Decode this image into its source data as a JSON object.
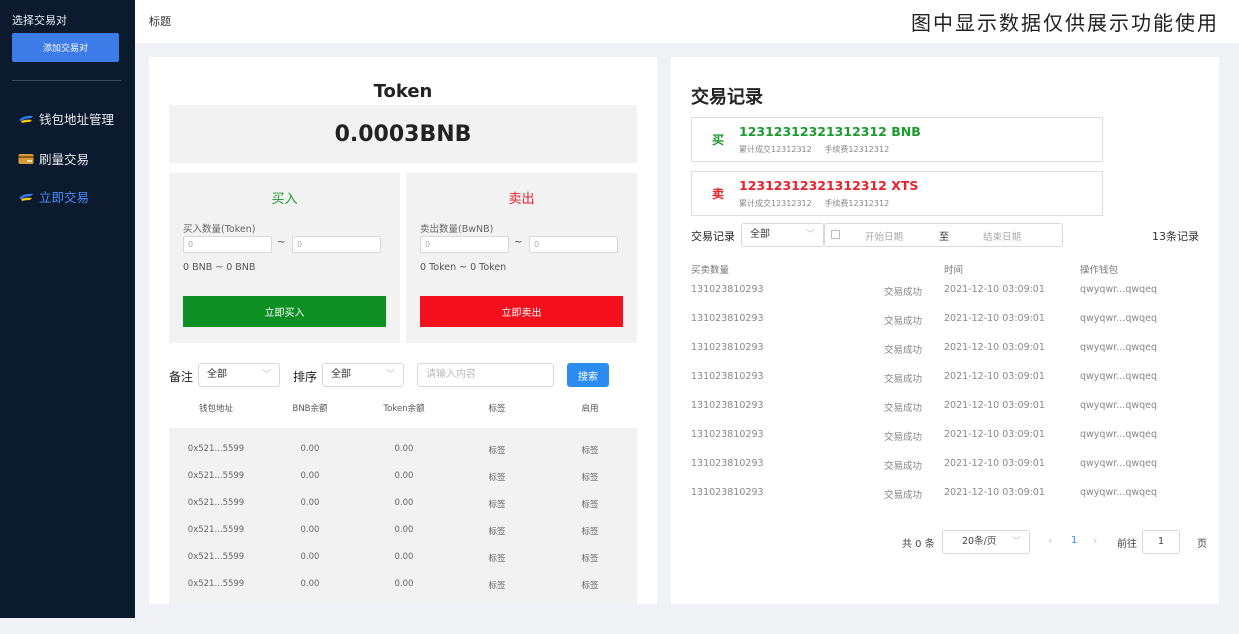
{
  "sidebar": {
    "title": "选择交易对",
    "add_button": "添加交易对",
    "items": [
      {
        "label": "钱包地址管理",
        "icon": "wallet-icon",
        "active": false
      },
      {
        "label": "刷量交易",
        "icon": "card-icon",
        "active": false
      },
      {
        "label": "立即交易",
        "icon": "wallet-icon",
        "active": true
      }
    ]
  },
  "header": {
    "breadcrumb": "标题",
    "notice": "图中显示数据仅供展示功能使用"
  },
  "token_panel": {
    "title": "Token",
    "price": "0.0003BNB",
    "buy": {
      "title": "买入",
      "quantity_label": "买入数量(Token)",
      "min_placeholder": "0",
      "max_placeholder": "0",
      "separator": "~",
      "range_text": "0 BNB ~ 0 BNB",
      "button": "立即买入"
    },
    "sell": {
      "title": "卖出",
      "quantity_label": "卖出数量(BwNB)",
      "min_placeholder": "0",
      "max_placeholder": "0",
      "separator": "~",
      "range_text": "0 Token ~ 0 Token",
      "button": "立即卖出"
    }
  },
  "wallet_filter": {
    "note_label": "备注",
    "note_value": "全部",
    "sort_label": "排序",
    "sort_value": "全部",
    "search_placeholder": "请输入内容",
    "search_button": "搜索"
  },
  "wallet_table": {
    "columns": [
      "钱包地址",
      "BNB余额",
      "Token余额",
      "标签",
      "启用"
    ],
    "rows": [
      [
        "0x521...5599",
        "0.00",
        "0.00",
        "标签",
        "标签"
      ],
      [
        "0x521...5599",
        "0.00",
        "0.00",
        "标签",
        "标签"
      ],
      [
        "0x521...5599",
        "0.00",
        "0.00",
        "标签",
        "标签"
      ],
      [
        "0x521...5599",
        "0.00",
        "0.00",
        "标签",
        "标签"
      ],
      [
        "0x521...5599",
        "0.00",
        "0.00",
        "标签",
        "标签"
      ],
      [
        "0x521...5599",
        "0.00",
        "0.00",
        "标签",
        "标签"
      ]
    ]
  },
  "records": {
    "title": "交易记录",
    "buy_summary": {
      "side": "买",
      "main": "12312312321312312 BNB",
      "sub1": "累计成交12312312",
      "sub2": "手续费12312312"
    },
    "sell_summary": {
      "side": "卖",
      "main": "12312312321312312 XTS",
      "sub1": "累计成交12312312",
      "sub2": "手续费12312312"
    },
    "filter_label": "交易记录",
    "filter_value": "全部",
    "start_placeholder": "开始日期",
    "date_separator": "至",
    "end_placeholder": "结束日期",
    "count": "13条记录",
    "columns": [
      "买卖数量",
      "",
      "时间",
      "操作钱包"
    ],
    "rows": [
      [
        "131023810293",
        "交易成功",
        "2021-12-10 03:09:01",
        "qwyqwr...qwqeq"
      ],
      [
        "131023810293",
        "交易成功",
        "2021-12-10 03:09:01",
        "qwyqwr...qwqeq"
      ],
      [
        "131023810293",
        "交易成功",
        "2021-12-10 03:09:01",
        "qwyqwr...qwqeq"
      ],
      [
        "131023810293",
        "交易成功",
        "2021-12-10 03:09:01",
        "qwyqwr...qwqeq"
      ],
      [
        "131023810293",
        "交易成功",
        "2021-12-10 03:09:01",
        "qwyqwr...qwqeq"
      ],
      [
        "131023810293",
        "交易成功",
        "2021-12-10 03:09:01",
        "qwyqwr...qwqeq"
      ],
      [
        "131023810293",
        "交易成功",
        "2021-12-10 03:09:01",
        "qwyqwr...qwqeq"
      ],
      [
        "131023810293",
        "交易成功",
        "2021-12-10 03:09:01",
        "qwyqwr...qwqeq"
      ]
    ],
    "pager": {
      "total": "共 0 条",
      "page_size": "20条/页",
      "prev": "‹",
      "current": "1",
      "next": "›",
      "goto_label": "前往",
      "goto_value": "1",
      "page_suffix": "页"
    }
  },
  "colors": {
    "sidebar_bg": "#0b1a2c",
    "primary": "#3d7be8",
    "buy_green": "#0d8f24",
    "sell_red": "#f40f1c",
    "search_blue": "#2d8cf0"
  }
}
